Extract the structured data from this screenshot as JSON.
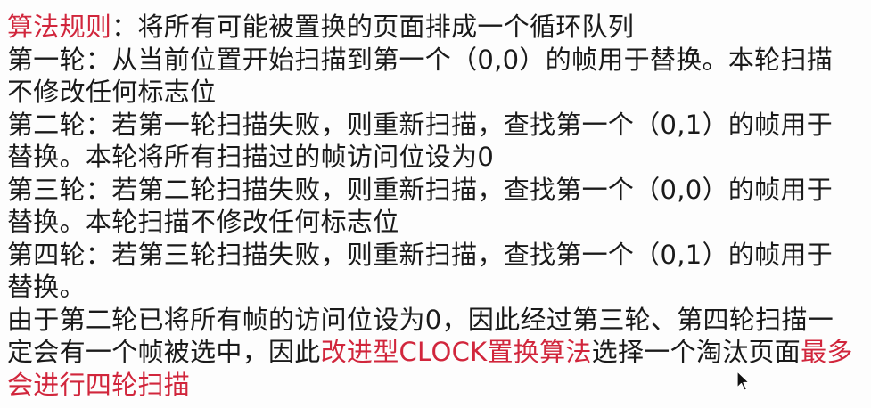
{
  "rule": {
    "heading": "算法规则",
    "text": "：将所有可能被置换的页面排成一个循环队列"
  },
  "rounds": {
    "r1_l1": "第一轮：从当前位置开始扫描到第一个（0,0）的帧用于替换。本轮扫描",
    "r1_l2": "不修改任何标志位",
    "r2_l1": "第二轮：若第一轮扫描失败，则重新扫描，查找第一个（0,1）的帧用于",
    "r2_l2": "替换。本轮将所有扫描过的帧访问位设为0",
    "r3_l1": "第三轮：若第二轮扫描失败，则重新扫描，查找第一个（0,0）的帧用于",
    "r3_l2": "替换。本轮扫描不修改任何标志位",
    "r4_l1": "第四轮：若第三轮扫描失败，则重新扫描，查找第一个（0,1）的帧用于",
    "r4_l2": "替换。"
  },
  "conclusion": {
    "l1": "由于第二轮已将所有帧的访问位设为0，因此经过第三轮、第四轮扫描一",
    "l2_a": "定会有一个帧被选中，因此",
    "l2_red1": "改进型CLOCK置换算法",
    "l2_b": "选择一个淘汰页面",
    "l2_red2": "最多",
    "l3_red": "会进行四轮扫描"
  },
  "colors": {
    "text": "#1a1a1a",
    "highlight": "#d1263c"
  }
}
